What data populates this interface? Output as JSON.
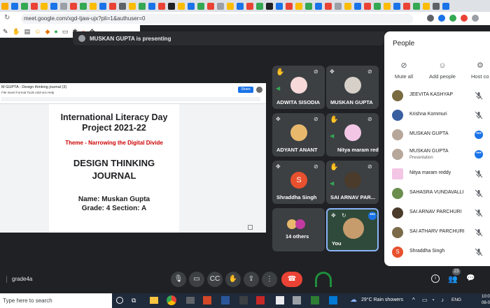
{
  "browser": {
    "url": "meet.google.com/xgd-tjaw-ujx?pli=1&authuser=0",
    "tab_colors": [
      "#f9ab00",
      "#1a73e8",
      "#34a853",
      "#ea4335",
      "#fbbc04",
      "#1a73e8",
      "#9aa0a6",
      "#ea4335",
      "#34a853",
      "#fbbc04",
      "#1a73e8",
      "#ea4335",
      "#5f6368",
      "#fbbc04",
      "#34a853",
      "#1a73e8",
      "#ea4335",
      "#202124",
      "#fbbc04",
      "#1a73e8",
      "#34a853",
      "#ea4335",
      "#9aa0a6",
      "#fbbc04",
      "#1a73e8",
      "#ea4335",
      "#34a853",
      "#202124",
      "#1a73e8",
      "#ea4335",
      "#fbbc04",
      "#34a853",
      "#1a73e8",
      "#ea4335",
      "#9aa0a6",
      "#fbbc04",
      "#1a73e8",
      "#ea4335",
      "#34a853",
      "#fbbc04",
      "#1a73e8",
      "#ea4335",
      "#34a853",
      "#fbbc04",
      "#5f6368",
      "#1a73e8"
    ]
  },
  "banner": {
    "text": "MUSKAN GUPTA is presenting"
  },
  "presentation": {
    "doc_title": "M GUPTA - Design thinking journal (3)",
    "menu": "File  Insert  Format  Tools  Add-ons  Help",
    "share_label": "Share",
    "page": {
      "title1": "International Literacy Day",
      "title2": "Project 2021-22",
      "theme": "Theme - Narrowing the Digital Divide",
      "heading1": "DESIGN THINKING",
      "heading2": "JOURNAL",
      "name_line": "Name: Muskan Gupta",
      "grade_line": "Grade: 4 Section: A"
    }
  },
  "tiles": [
    {
      "name": "ADWITA SISODIA",
      "avatar_color": "#f7d9d9"
    },
    {
      "name": "MUSKAN GUPTA",
      "avatar_color": "#d6d0c8"
    },
    {
      "name": "ADYANT ANANT",
      "avatar_color": "#e8b86d"
    },
    {
      "name": "Nitya maram red...",
      "avatar_color": "#f4c6e6"
    },
    {
      "name": "Shraddha Singh",
      "avatar_letter": "S",
      "avatar_color": "#e8502e"
    },
    {
      "name": "SAI ARNAV PAR...",
      "avatar_color": "#4a3b2a"
    },
    {
      "name": "14 others"
    },
    {
      "name": "You"
    }
  ],
  "people_panel": {
    "title": "People",
    "actions": [
      {
        "label": "Mute all",
        "icon": "mic-off-icon"
      },
      {
        "label": "Add people",
        "icon": "person-add-icon"
      },
      {
        "label": "Host co",
        "icon": "host-controls-icon"
      }
    ],
    "participants": [
      {
        "name": "JEEVITA KASHYAP",
        "avatar_color": "#7a6a40"
      },
      {
        "name": "Krishna Kommuri",
        "avatar_color": "#3a5fa0"
      },
      {
        "name": "MUSKAN GUPTA",
        "avatar_color": "#b7a79a",
        "more": true
      },
      {
        "name": "MUSKAN GUPTA",
        "sub": "Presentation",
        "avatar_color": "#b7a79a",
        "more": true
      },
      {
        "name": "Nitya maram reddy",
        "avatar_color": "#f4c6e6"
      },
      {
        "name": "SAHASRA VUNDAVALLI",
        "avatar_color": "#6b8e4e"
      },
      {
        "name": "SAI ARNAV PARCHURI",
        "avatar_color": "#4a3b2a"
      },
      {
        "name": "SAI ATHARV PARCHURI",
        "avatar_color": "#7b6b4b"
      },
      {
        "name": "Shraddha Singh",
        "avatar_color": "#e8502e",
        "avatar_letter": "S"
      }
    ]
  },
  "meeting": {
    "meeting_name": "grade4a",
    "people_count": "23"
  },
  "taskbar": {
    "search_placeholder": "Type here to search",
    "weather": "29°C  Rain showers",
    "lang": "ENG",
    "time": "10:0",
    "date": "08-0"
  }
}
